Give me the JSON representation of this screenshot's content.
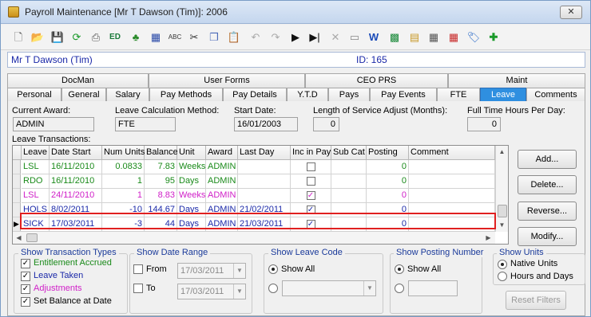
{
  "window": {
    "title": "Payroll Maintenance  [Mr T Dawson (Tim)]:  2006",
    "close_glyph": "✕"
  },
  "toolbar": {
    "icons": [
      "new-document-icon",
      "open-folder-icon",
      "save-icon",
      "refresh-icon",
      "print-icon",
      "edi-icon",
      "tree-icon",
      "calculator-icon",
      "spellcheck-icon",
      "cut-icon",
      "copy-icon",
      "paste-icon",
      "undo-icon",
      "redo-icon",
      "play-icon",
      "play-to-end-icon",
      "delete-icon",
      "preview-icon",
      "word-icon",
      "grid-icon",
      "notes-icon",
      "calendar-icon",
      "calendar-delete-icon",
      "tag-icon",
      "add-icon"
    ]
  },
  "employee": {
    "name": "Mr T Dawson (Tim)",
    "id_text": "ID: 165"
  },
  "tabs_top": [
    "DocMan",
    "User Forms",
    "CEO PRS",
    "Maint"
  ],
  "tabs_bottom": [
    "Personal",
    "General",
    "Salary",
    "Pay Methods",
    "Pay Details",
    "Y.T.D",
    "Pays",
    "Pay Events",
    "FTE",
    "Leave",
    "Comments"
  ],
  "active_tab": "Leave",
  "fields": {
    "current_award_label": "Current Award:",
    "current_award_value": "ADMIN",
    "leave_calc_label": "Leave Calculation Method:",
    "leave_calc_value": "FTE",
    "start_date_label": "Start Date:",
    "start_date_value": "16/01/2003",
    "los_label": "Length of Service Adjust (Months):",
    "los_value": "0",
    "fte_label": "Full Time Hours Per Day:",
    "fte_value": "0"
  },
  "transactions": {
    "label": "Leave Transactions:",
    "columns": [
      "Leave",
      "Date Start",
      "Num Units",
      "Balance",
      "Unit",
      "Award",
      "Last Day",
      "Inc in Pay",
      "Sub Cat",
      "Posting",
      "Comment"
    ],
    "rows": [
      {
        "leave": "LSL",
        "date_start": "16/11/2010",
        "num_units": "0.0833",
        "balance": "7.83",
        "unit": "Weeks",
        "award": "ADMIN",
        "last_day": "",
        "inc_in_pay": false,
        "sub_cat": "",
        "posting": "0",
        "comment": "",
        "color": "#1a8a1a"
      },
      {
        "leave": "RDO",
        "date_start": "16/11/2010",
        "num_units": "1",
        "balance": "95",
        "unit": "Days",
        "award": "ADMIN",
        "last_day": "",
        "inc_in_pay": false,
        "sub_cat": "",
        "posting": "0",
        "comment": "",
        "color": "#1a8a1a"
      },
      {
        "leave": "LSL",
        "date_start": "24/11/2010",
        "num_units": "1",
        "balance": "8.83",
        "unit": "Weeks",
        "award": "ADMIN",
        "last_day": "",
        "inc_in_pay": true,
        "sub_cat": "",
        "posting": "0",
        "comment": "",
        "color": "#d020c8"
      },
      {
        "leave": "HOLS",
        "date_start": "8/02/2011",
        "num_units": "-10",
        "balance": "144.67",
        "unit": "Days",
        "award": "ADMIN",
        "last_day": "21/02/2011",
        "inc_in_pay": true,
        "sub_cat": "",
        "posting": "0",
        "comment": "",
        "color": "#1a28a8"
      },
      {
        "leave": "SICK",
        "date_start": "17/03/2011",
        "num_units": "-3",
        "balance": "44",
        "unit": "Days",
        "award": "ADMIN",
        "last_day": "21/03/2011",
        "inc_in_pay": true,
        "sub_cat": "",
        "posting": "0",
        "comment": "",
        "color": "#1a28a8"
      }
    ],
    "current_row_marker": "▶"
  },
  "buttons": {
    "add": "Add...",
    "delete": "Delete...",
    "reverse": "Reverse...",
    "modify": "Modify...",
    "reset": "Reset Filters"
  },
  "filters": {
    "types": {
      "title": "Show Transaction Types",
      "items": [
        {
          "label": "Entitlement Accrued",
          "checked": true,
          "color": "#1a8a1a"
        },
        {
          "label": "Leave Taken",
          "checked": true,
          "color": "#1a28a8"
        },
        {
          "label": "Adjustments",
          "checked": true,
          "color": "#d020c8"
        },
        {
          "label": "Set Balance at Date",
          "checked": true,
          "color": "#000000"
        }
      ]
    },
    "date_range": {
      "title": "Show Date Range",
      "from_label": "From",
      "from_value": "17/03/2011",
      "to_label": "To",
      "to_value": "17/03/2011"
    },
    "leave_code": {
      "title": "Show Leave Code",
      "show_all": "Show All"
    },
    "posting": {
      "title": "Show Posting Number",
      "show_all": "Show All"
    },
    "units": {
      "title": "Show Units",
      "native": "Native Units",
      "hours_days": "Hours and Days"
    }
  }
}
